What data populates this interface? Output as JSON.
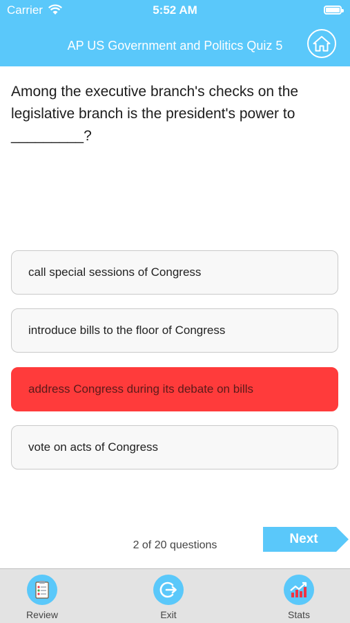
{
  "status_bar": {
    "carrier": "Carrier",
    "time": "5:52 AM"
  },
  "header": {
    "title": "AP US Government and Politics Quiz 5"
  },
  "question": {
    "text": "Among the executive branch's checks on the legislative branch is the president's power to _________?"
  },
  "answers": [
    {
      "label": "call special sessions of Congress",
      "state": "default"
    },
    {
      "label": "introduce bills to the floor of Congress",
      "state": "default"
    },
    {
      "label": "address Congress during its debate on bills",
      "state": "wrong"
    },
    {
      "label": "vote on acts of Congress",
      "state": "default"
    }
  ],
  "progress": {
    "text": "2 of 20 questions"
  },
  "next_button": {
    "label": "Next"
  },
  "tabs": [
    {
      "label": "Review",
      "icon": "review-icon"
    },
    {
      "label": "Exit",
      "icon": "exit-icon"
    },
    {
      "label": "Stats",
      "icon": "stats-icon"
    }
  ],
  "colors": {
    "accent": "#5ac8fa",
    "wrong": "#ff3b3b"
  }
}
